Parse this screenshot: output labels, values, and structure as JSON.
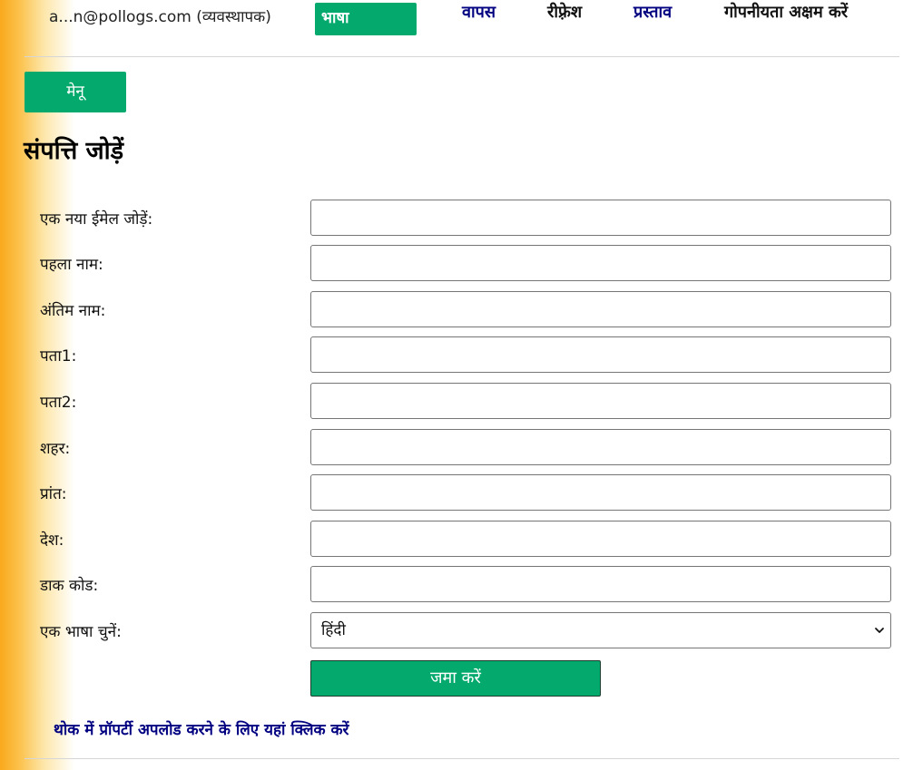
{
  "header": {
    "user_email": "a...n@pollogs.com (व्यवस्थापक)",
    "language_button": "भाषा",
    "nav": {
      "back": "वापस",
      "refresh": "रीफ़्रेश",
      "proposal": "प्रस्ताव",
      "privacy": "गोपनीयता अक्षम करें"
    }
  },
  "menu_button": "मेनू",
  "page_title": "संपत्ति जोड़ें",
  "form": {
    "fields": [
      {
        "label": "एक नया ईमेल जोड़ें:",
        "value": ""
      },
      {
        "label": "पहला नाम:",
        "value": ""
      },
      {
        "label": "अंतिम नाम:",
        "value": ""
      },
      {
        "label": "पता1:",
        "value": ""
      },
      {
        "label": "पता2:",
        "value": ""
      },
      {
        "label": "शहर:",
        "value": ""
      },
      {
        "label": "प्रांत:",
        "value": ""
      },
      {
        "label": "देश:",
        "value": ""
      },
      {
        "label": "डाक कोड:",
        "value": ""
      }
    ],
    "language_select": {
      "label": "एक भाषा चुनें:",
      "selected": "हिंदी"
    },
    "submit_label": "जमा करें"
  },
  "bulk_upload_link": "थोक में प्रॉपर्टी अपलोड करने के लिए यहां क्लिक करें",
  "colors": {
    "accent_green": "#04aa6d",
    "link_navy": "#000080",
    "sidebar_orange": "#f9a91c"
  },
  "icons": {
    "select_arrow": "chevron-down-icon"
  }
}
